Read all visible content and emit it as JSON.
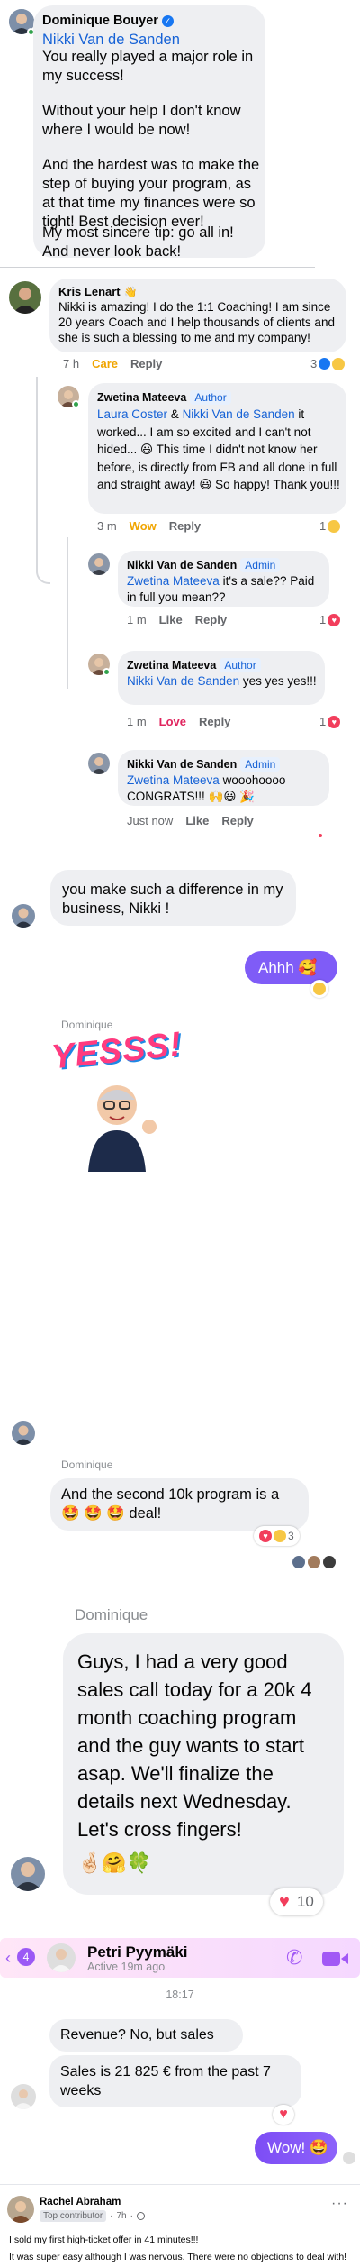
{
  "top_comment": {
    "author": "Dominique Bouyer",
    "mention": "Nikki Van de Sanden",
    "p1": "You really played a major role in my success!",
    "p2": "Without your help I don't know where I would be now!",
    "p3": "And the hardest was to make the step of buying your program, as at that time my finances were so tight! Best decision ever!",
    "p4": "My most sincere tip: go all in! And never look back!"
  },
  "kris": {
    "author": "Kris Lenart",
    "text": "Nikki is amazing! I do the 1:1 Coaching! I am since 20 years Coach and I help thousands of clients and she is such a blessing to me and my company!",
    "time": "7 h",
    "reaction_label": "Care",
    "reply": "Reply",
    "count": "3"
  },
  "zwetina1": {
    "author": "Zwetina Mateeva",
    "badge": "Author",
    "mention1": "Laura Coster",
    "amp": " & ",
    "mention2": "Nikki Van de Sanden",
    "text": "it worked... I am so excited and I can't not hided... 😃 This time I didn't not know her before, is directly from FB and all done in full and straight away! 😃 So happy! Thank you!!!",
    "time": "3 m",
    "reaction_label": "Wow",
    "reply": "Reply",
    "count": "1"
  },
  "nikki1": {
    "author": "Nikki Van de Sanden",
    "badge": "Admin",
    "mention": "Zwetina Mateeva",
    "text": "it's a sale?? Paid in full you mean??",
    "time": "1 m",
    "like": "Like",
    "reply": "Reply",
    "count": "1"
  },
  "zwetina2": {
    "author": "Zwetina Mateeva",
    "badge": "Author",
    "mention": "Nikki Van de Sanden",
    "text": "yes yes yes!!!",
    "time": "1 m",
    "reaction_label": "Love",
    "reply": "Reply",
    "count": "1"
  },
  "nikki2": {
    "author": "Nikki Van de Sanden",
    "badge": "Admin",
    "mention": "Zwetina Mateeva",
    "text": "wooohoooo CONGRATS!!! 🙌😃 🎉",
    "time": "Just now",
    "like": "Like",
    "reply": "Reply",
    "count": "1"
  },
  "chat1": {
    "incoming": "you make such a difference in my business, Nikki !",
    "outgoing": "Ahhh 🥰",
    "sender_label": "Dominique",
    "sticker_text": "YESSS!",
    "sender_label2": "Dominique",
    "incoming2": "And the second 10k program is a 🤩 🤩 🤩 deal!",
    "reaction_count": "3"
  },
  "chat2": {
    "sender_label": "Dominique",
    "text": "Guys, I had a very good sales call today for a 20k 4 month coaching program and the guy wants to start asap. We'll finalize the details next Wednesday. Let's cross fingers!",
    "emojis": "🤞🏻🤗🍀",
    "reaction_count": "10"
  },
  "messenger": {
    "back_count": "4",
    "contact_name": "Petri Pyymäki",
    "status": "Active 19m ago",
    "time": "18:17",
    "msg1": "Revenue? No, but sales",
    "msg2": "Sales is 21 825 € from the past 7 weeks",
    "outgoing": "Wow! 🤩"
  },
  "post": {
    "author": "Rachel Abraham",
    "badge": "Top contributor",
    "time": "7h",
    "line1": "I sold my first high-ticket offer in 41 minutes!!!",
    "line2": "It was super easy although I was nervous. There were no objections to deal with!"
  },
  "colors": {
    "link": "#1662d6",
    "care": "#f0a500",
    "wow": "#f0a500",
    "love": "#e0245e",
    "messenger_purple": "#7f5cf7",
    "online": "#31a24c"
  }
}
